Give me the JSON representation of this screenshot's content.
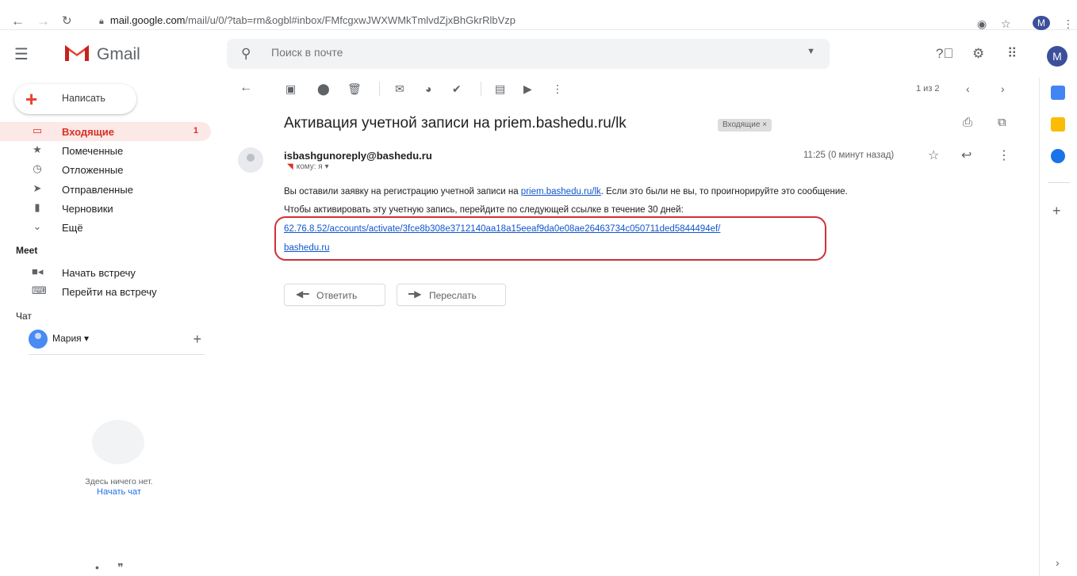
{
  "browser": {
    "url_host": "mail.google.com",
    "url_path": "/mail/u/0/?tab=rm&ogbl#inbox/FMfcgxwJWXWMkTmlvdZjxBhGkrRlbVzp",
    "avatar_letter": "M"
  },
  "header": {
    "app_name": "Gmail",
    "search_placeholder": "Поиск в почте",
    "avatar_letter": "M"
  },
  "sidebar": {
    "compose_label": "Написать",
    "items": [
      {
        "label": "Входящие",
        "count": "1",
        "icon": "inbox-icon"
      },
      {
        "label": "Помеченные",
        "count": "",
        "icon": "star-icon"
      },
      {
        "label": "Отложенные",
        "count": "",
        "icon": "clock-icon"
      },
      {
        "label": "Отправленные",
        "count": "",
        "icon": "send-icon"
      },
      {
        "label": "Черновики",
        "count": "",
        "icon": "draft-icon"
      },
      {
        "label": "Ещё",
        "count": "",
        "icon": "chevron-down-icon"
      }
    ],
    "meet_title": "Meet",
    "meet_items": [
      {
        "label": "Начать встречу",
        "icon": "video-icon"
      },
      {
        "label": "Перейти на встречу",
        "icon": "keyboard-icon"
      }
    ],
    "chat_title": "Чат",
    "chat_user": "Мария",
    "empty_text": "Здесь ничего нет.",
    "start_chat": "Начать чат"
  },
  "toolbar": {
    "pager": "1 из 2"
  },
  "message": {
    "subject": "Активация учетной записи на priem.bashedu.ru/lk",
    "label": "Входящие ×",
    "sender": "isbashgunoreply@bashedu.ru",
    "recipient": "кому: я",
    "time": "11:25 (0 минут назад)",
    "line1_pre": "Вы оставили заявку на регистрацию учетной записи на ",
    "line1_link": "priem.bashedu.ru/lk",
    "line1_post": ". Если это были не вы, то проигнорируйте это сообщение.",
    "line2": "Чтобы активировать эту учетную запись, перейдите по следующей ссылке в течение 30 дней:",
    "activation_link": "62.76.8.52/accounts/activate/3fce8b308e3712140aa18a15eeaf9da0e08ae26463734c050711ded5844494ef/",
    "link2": "bashedu.ru",
    "reply_label": "Ответить",
    "forward_label": "Переслать"
  },
  "colors": {
    "accent_red": "#d93025",
    "link_blue": "#1155cc",
    "highlight_red": "#d03038"
  }
}
